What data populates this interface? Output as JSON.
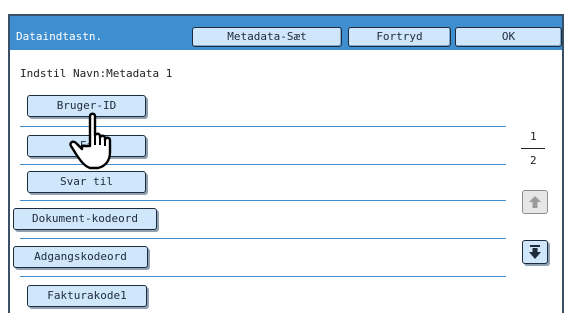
{
  "header": {
    "title": "Dataindtastn.",
    "buttons": [
      "Metadata-Sæt",
      "Fortryd",
      "OK"
    ]
  },
  "subtitle": "Indstil Navn:Metadata 1",
  "items": [
    {
      "label": "Bruger-ID"
    },
    {
      "label": "Fa"
    },
    {
      "label": "Svar til"
    },
    {
      "label": "Dokument-kodeord"
    },
    {
      "label": "Adgangskodeord"
    },
    {
      "label": "Fakturakode1"
    }
  ],
  "pager": {
    "current": "1",
    "total": "2"
  },
  "icons": {
    "up": "arrow-up-icon",
    "down": "arrow-down-icon",
    "cursor": "pointing-hand-icon"
  },
  "colors": {
    "header": "#3f8fd0",
    "button": "#cfe6fb",
    "border": "#1d2b3a"
  }
}
